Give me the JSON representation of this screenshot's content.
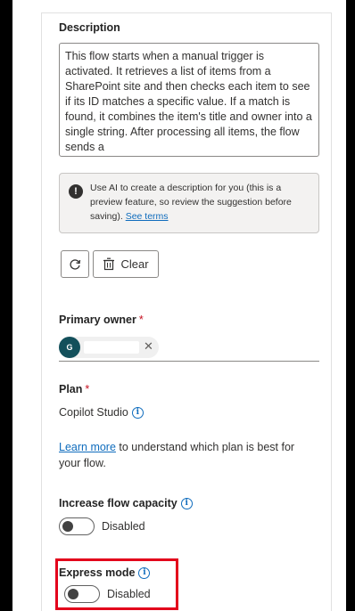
{
  "description": {
    "label": "Description",
    "text": "This flow starts when a manual trigger is activated. It retrieves a list of items from a SharePoint site and then checks each item to see if its ID matches a specific value. If a match is found, it combines the item's title and owner into a single string. After processing all items, the flow sends a"
  },
  "ai_notice": {
    "icon": "info-filled-icon",
    "text": "Use AI to create a description for you (this is a preview feature, so review the suggestion before saving).",
    "link": "See terms"
  },
  "actions": {
    "refresh_icon": "refresh-icon",
    "clear_icon": "trash-icon",
    "clear_label": "Clear"
  },
  "primary_owner": {
    "label": "Primary owner",
    "required": "*",
    "avatar_initial": "G",
    "remove": "✕"
  },
  "plan": {
    "label": "Plan",
    "required": "*",
    "value": "Copilot Studio"
  },
  "learn_more": {
    "link": "Learn more",
    "text": " to understand which plan is best for your flow."
  },
  "flow_capacity": {
    "label": "Increase flow capacity",
    "state": "Disabled"
  },
  "express_mode": {
    "label": "Express mode",
    "state": "Disabled"
  },
  "colors": {
    "accent": "#0f6cbd",
    "highlight": "#e3001b",
    "avatar": "#13505b"
  }
}
